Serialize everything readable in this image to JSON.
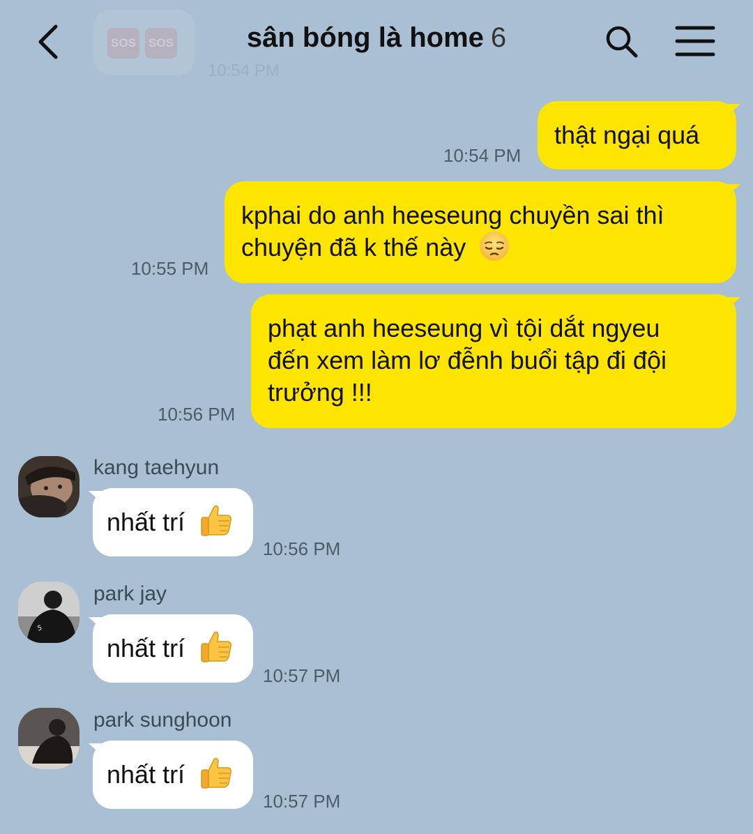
{
  "header": {
    "title": "sân bóng là home",
    "member_count": "6",
    "ghost_badge_1": "SOS",
    "ghost_badge_2": "SOS",
    "ghost_time": "10:54 PM"
  },
  "icons": {
    "back": "chevron-left-icon",
    "search": "search-icon",
    "menu": "menu-icon",
    "pensive": "pensive-face-emoji",
    "thumbs_up": "thumbs-up-emoji"
  },
  "colors": {
    "background": "#a9bfd3",
    "my_bubble": "#fee500",
    "their_bubble": "#ffffff"
  },
  "messages": [
    {
      "from": "me",
      "text": "thật ngại quá",
      "time": "10:54 PM"
    },
    {
      "from": "me",
      "line1": "kphai do anh heeseung chuyền sai thì",
      "line2": "chuyện đã k thế này",
      "emoji": "😔",
      "time": "10:55 PM"
    },
    {
      "from": "me",
      "line1": "phạt anh heeseung vì tội dắt ngyeu",
      "line2": "đến xem làm lơ đễnh buổi tập đi đội",
      "line3": "trưởng !!!",
      "time": "10:56 PM"
    },
    {
      "from": "kang taehyun",
      "text": "nhất trí",
      "emoji": "👍",
      "time": "10:56 PM"
    },
    {
      "from": "park jay",
      "text": "nhất trí",
      "emoji": "👍",
      "time": "10:57 PM"
    },
    {
      "from": "park sunghoon",
      "text": "nhất trí",
      "emoji": "👍",
      "time": "10:57 PM"
    }
  ]
}
